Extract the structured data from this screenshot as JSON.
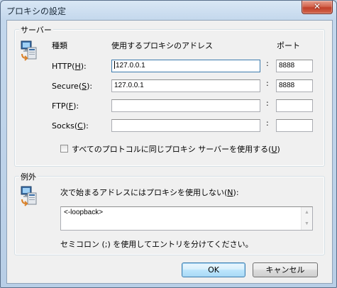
{
  "window": {
    "title": "プロキシの設定",
    "close_glyph": "✕"
  },
  "servers": {
    "group_title": "サーバー",
    "col_type": "種類",
    "col_address": "使用するプロキシのアドレス",
    "col_port": "ポート",
    "rows": [
      {
        "label": "HTTP(",
        "key": "H",
        "label_end": "):",
        "address": "127.0.0.1",
        "port": "8888",
        "focused": true
      },
      {
        "label": "Secure(",
        "key": "S",
        "label_end": "):",
        "address": "127.0.0.1",
        "port": "8888",
        "focused": false
      },
      {
        "label": "FTP(",
        "key": "F",
        "label_end": "):",
        "address": "",
        "port": "",
        "focused": false
      },
      {
        "label": "Socks(",
        "key": "C",
        "label_end": "):",
        "address": "",
        "port": "",
        "focused": false
      }
    ],
    "colon": ":",
    "same_proxy_label": "すべてのプロトコルに同じプロキシ サーバーを使用する(",
    "same_proxy_key": "U",
    "same_proxy_end": ")",
    "same_proxy_checked": false
  },
  "exceptions": {
    "group_title": "例外",
    "prompt": "次で始まるアドレスにはプロキシを使用しない(",
    "prompt_key": "N",
    "prompt_end": "):",
    "value": "<-loopback>",
    "hint": "セミコロン (;) を使用してエントリを分けてください。",
    "scroll_up_glyph": "▲",
    "scroll_down_glyph": "▼"
  },
  "buttons": {
    "ok": "OK",
    "cancel": "キャンセル"
  },
  "icons": {
    "servers_icon": "network-computers-icon",
    "exceptions_icon": "network-computers-icon"
  }
}
